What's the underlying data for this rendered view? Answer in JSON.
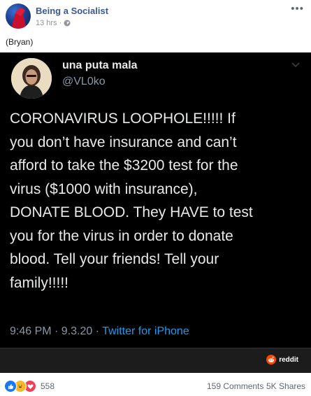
{
  "post": {
    "page_name": "Being a Socialist",
    "timestamp": "13 hrs ·",
    "privacy_icon": "globe-icon",
    "options_icon": "more-options-icon",
    "text": "(Bryan)"
  },
  "tweet": {
    "display_name": "una puta mala",
    "handle": "@VL0ko",
    "body": "CORONAVIRUS LOOPHOLE!!!!! If\nyou don’t have insurance and can’t\nafford to take the $3200 test for the\nvirus ($1000 with insurance),\nDONATE BLOOD. They HAVE to test\nyou for the virus in order to donate\nblood. Tell your friends! Tell your\nfamily!!!!!",
    "time": "9:46 PM · 9.3.20 · ",
    "source": "Twitter for iPhone",
    "watermark": "reddit"
  },
  "footer": {
    "reaction_count": "558",
    "comments": "159 Comments",
    "shares": "5K Shares",
    "reaction_icons": [
      "like-icon",
      "haha-icon",
      "love-icon"
    ]
  },
  "colors": {
    "link_blue": "#385898",
    "twitter_blue": "#1d9bf0",
    "like": "#1877f2",
    "haha": "#f7b928",
    "love": "#f33e58"
  }
}
